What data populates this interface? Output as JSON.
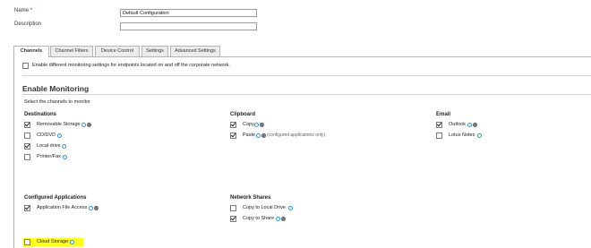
{
  "form": {
    "name_label": "Name",
    "required_mark": "*",
    "name_value": "Default Configuration",
    "description_label": "Description",
    "description_value": ""
  },
  "tabs": [
    {
      "label": "Channels",
      "active": true
    },
    {
      "label": "Channel Filters",
      "active": false
    },
    {
      "label": "Device Control",
      "active": false
    },
    {
      "label": "Settings",
      "active": false
    },
    {
      "label": "Advanced Settings",
      "active": false
    }
  ],
  "panel": {
    "different_settings_label": "Enable different monitoring settings for endpoints located on and off the corporate network.",
    "different_settings_checked": false,
    "enable_monitoring_title": "Enable Monitoring",
    "select_channels_text": "Select the channels to monitor"
  },
  "destinations": {
    "title": "Destinations",
    "items": [
      {
        "label": "Removable Storage",
        "checked": true,
        "icons": [
          "info-icon",
          "gear-icon"
        ]
      },
      {
        "label": "CD/DVD",
        "checked": false,
        "icons": [
          "info-icon"
        ]
      },
      {
        "label": "Local drive",
        "checked": true,
        "icons": [
          "info-icon"
        ]
      },
      {
        "label": "Printer/Fax",
        "checked": false,
        "icons": [
          "info-icon"
        ]
      }
    ]
  },
  "clipboard": {
    "title": "Clipboard",
    "items": [
      {
        "label": "Copy",
        "checked": true,
        "icons": [
          "info-icon",
          "gear-icon"
        ]
      },
      {
        "label": "Paste",
        "checked": true,
        "icons": [
          "info-icon",
          "gear-icon"
        ],
        "note": "(configured applications only)"
      }
    ]
  },
  "email": {
    "title": "Email",
    "items": [
      {
        "label": "Outlook",
        "checked": true,
        "icons": [
          "info-icon",
          "gear-icon"
        ]
      },
      {
        "label": "Lotus Notes",
        "checked": false,
        "icons": [
          "info-icon"
        ]
      }
    ]
  },
  "configured_apps": {
    "title": "Configured Applications",
    "items": [
      {
        "label": "Application File Access",
        "checked": true,
        "icons": [
          "info-icon",
          "gear-icon"
        ]
      },
      {
        "label": "Cloud Storage",
        "checked": false,
        "icons": [
          "info-icon"
        ],
        "highlighted": true,
        "highlight_color": "#ffff1a"
      }
    ]
  },
  "network_shares": {
    "title": "Network Shares",
    "items": [
      {
        "label": "Copy to Local Drive",
        "checked": false,
        "icons": [
          "info-icon"
        ]
      },
      {
        "label": "Copy to Share",
        "checked": true,
        "icons": [
          "info-icon",
          "gear-icon"
        ]
      }
    ]
  },
  "colors": {
    "required": "#cc0000",
    "info_icon": "#2a95d6",
    "gear_icon": "#7d7d7d",
    "highlight": "#ffff1a"
  }
}
